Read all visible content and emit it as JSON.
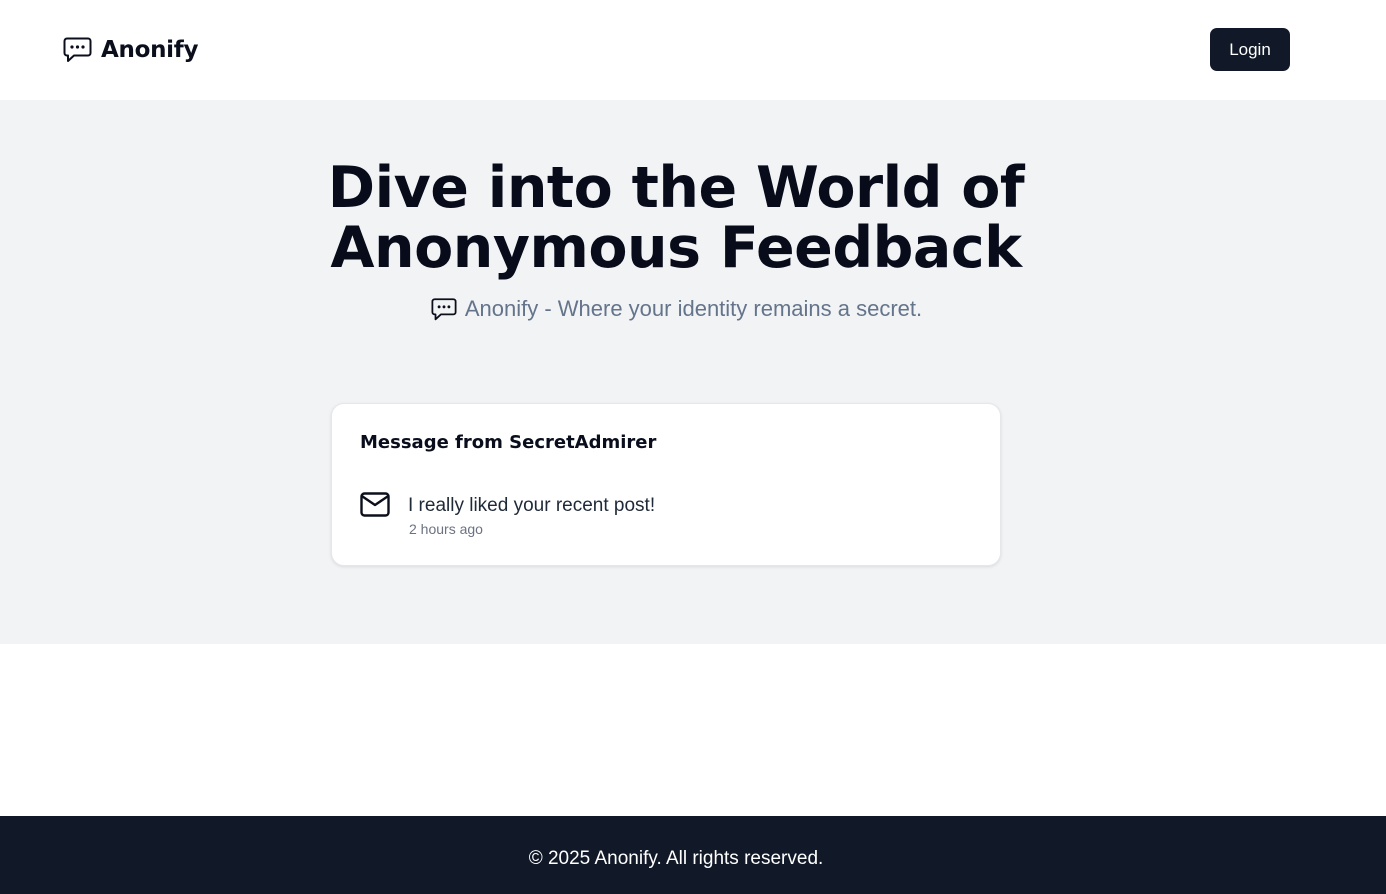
{
  "header": {
    "brand_name": "Anonify",
    "brand_icon": "message-dots-icon",
    "login_label": "Login"
  },
  "hero": {
    "title": "Dive into the World of Anonymous Feedback",
    "subtitle": "Anonify - Where your identity remains a secret.",
    "subtitle_icon": "message-dots-icon"
  },
  "message_card": {
    "title": "Message from SecretAdmirer",
    "icon": "mail-icon",
    "text": "I really liked your recent post!",
    "time": "2 hours ago"
  },
  "footer": {
    "copyright": "© 2025 Anonify. All rights reserved."
  },
  "colors": {
    "primary_dark": "#111827",
    "hero_background": "#f2f3f5",
    "muted_text": "#64748b"
  }
}
